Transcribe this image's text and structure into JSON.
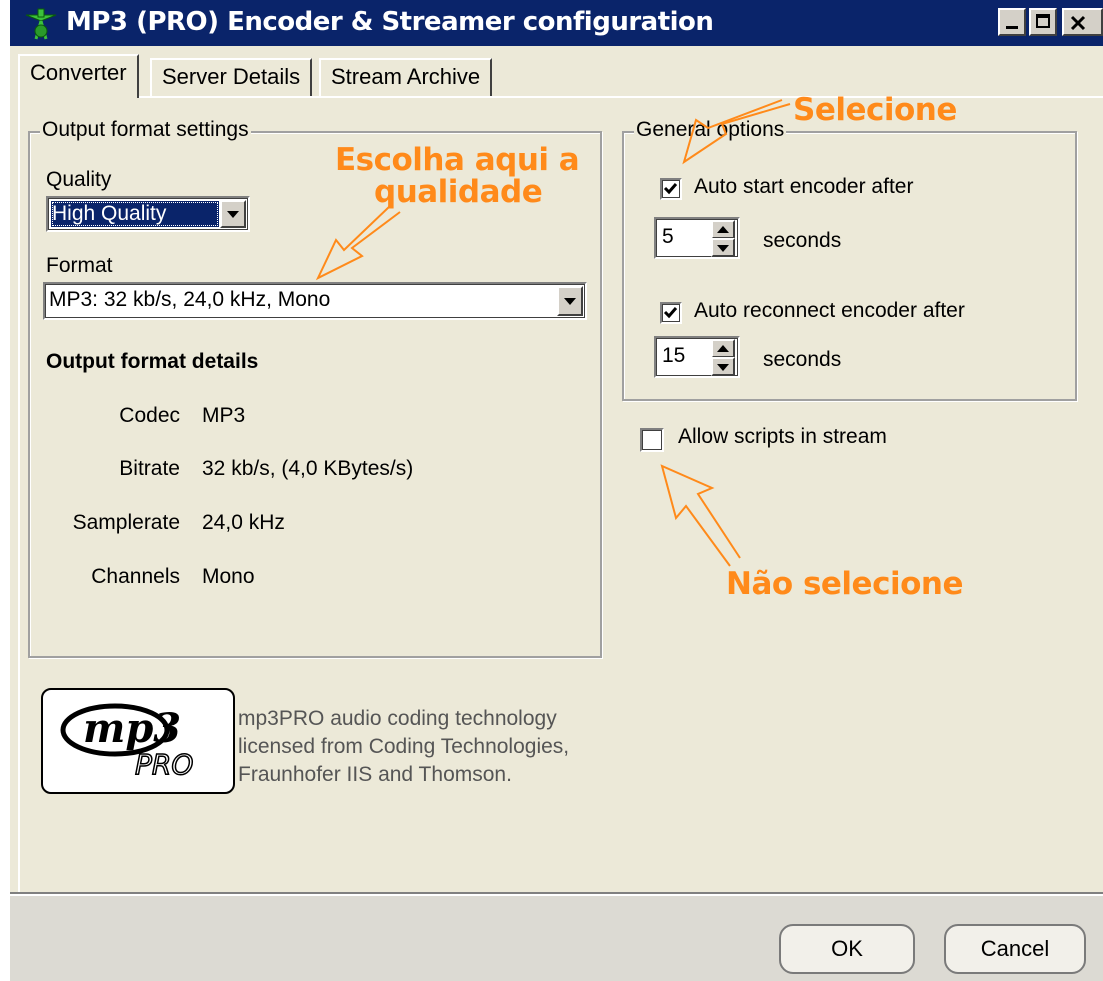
{
  "window": {
    "title": "MP3 (PRO) Encoder & Streamer configuration"
  },
  "tabs": [
    {
      "label": "Converter",
      "active": true
    },
    {
      "label": "Server Details",
      "active": false
    },
    {
      "label": "Stream Archive",
      "active": false
    }
  ],
  "output_settings": {
    "legend": "Output format settings",
    "quality_label": "Quality",
    "quality_value": "High Quality",
    "format_label": "Format",
    "format_value": "MP3: 32 kb/s, 24,0 kHz, Mono",
    "details_heading": "Output format details",
    "details": [
      {
        "key": "Codec",
        "value": "MP3"
      },
      {
        "key": "Bitrate",
        "value": "32 kb/s, (4,0 KBytes/s)"
      },
      {
        "key": "Samplerate",
        "value": "24,0 kHz"
      },
      {
        "key": "Channels",
        "value": "Mono"
      }
    ]
  },
  "general_options": {
    "legend": "General options",
    "auto_start_label": "Auto start encoder after",
    "auto_start_checked": true,
    "auto_start_seconds": "5",
    "auto_reconnect_label": "Auto reconnect encoder after",
    "auto_reconnect_checked": true,
    "auto_reconnect_seconds": "15",
    "seconds_label": "seconds"
  },
  "allow_scripts": {
    "label": "Allow scripts in stream",
    "checked": false
  },
  "logo": {
    "logo_text": "mp3 PRO",
    "caption_lines": [
      "mp3PRO audio coding technology",
      "licensed from Coding Technologies,",
      "Fraunhofer IIS and Thomson."
    ]
  },
  "annotations": {
    "quality": [
      "Escolha aqui  a",
      "qualidade"
    ],
    "select": "Selecione",
    "dont_select": "Não selecione",
    "color": "#ff8a1a"
  },
  "buttons": {
    "ok": "OK",
    "cancel": "Cancel"
  }
}
